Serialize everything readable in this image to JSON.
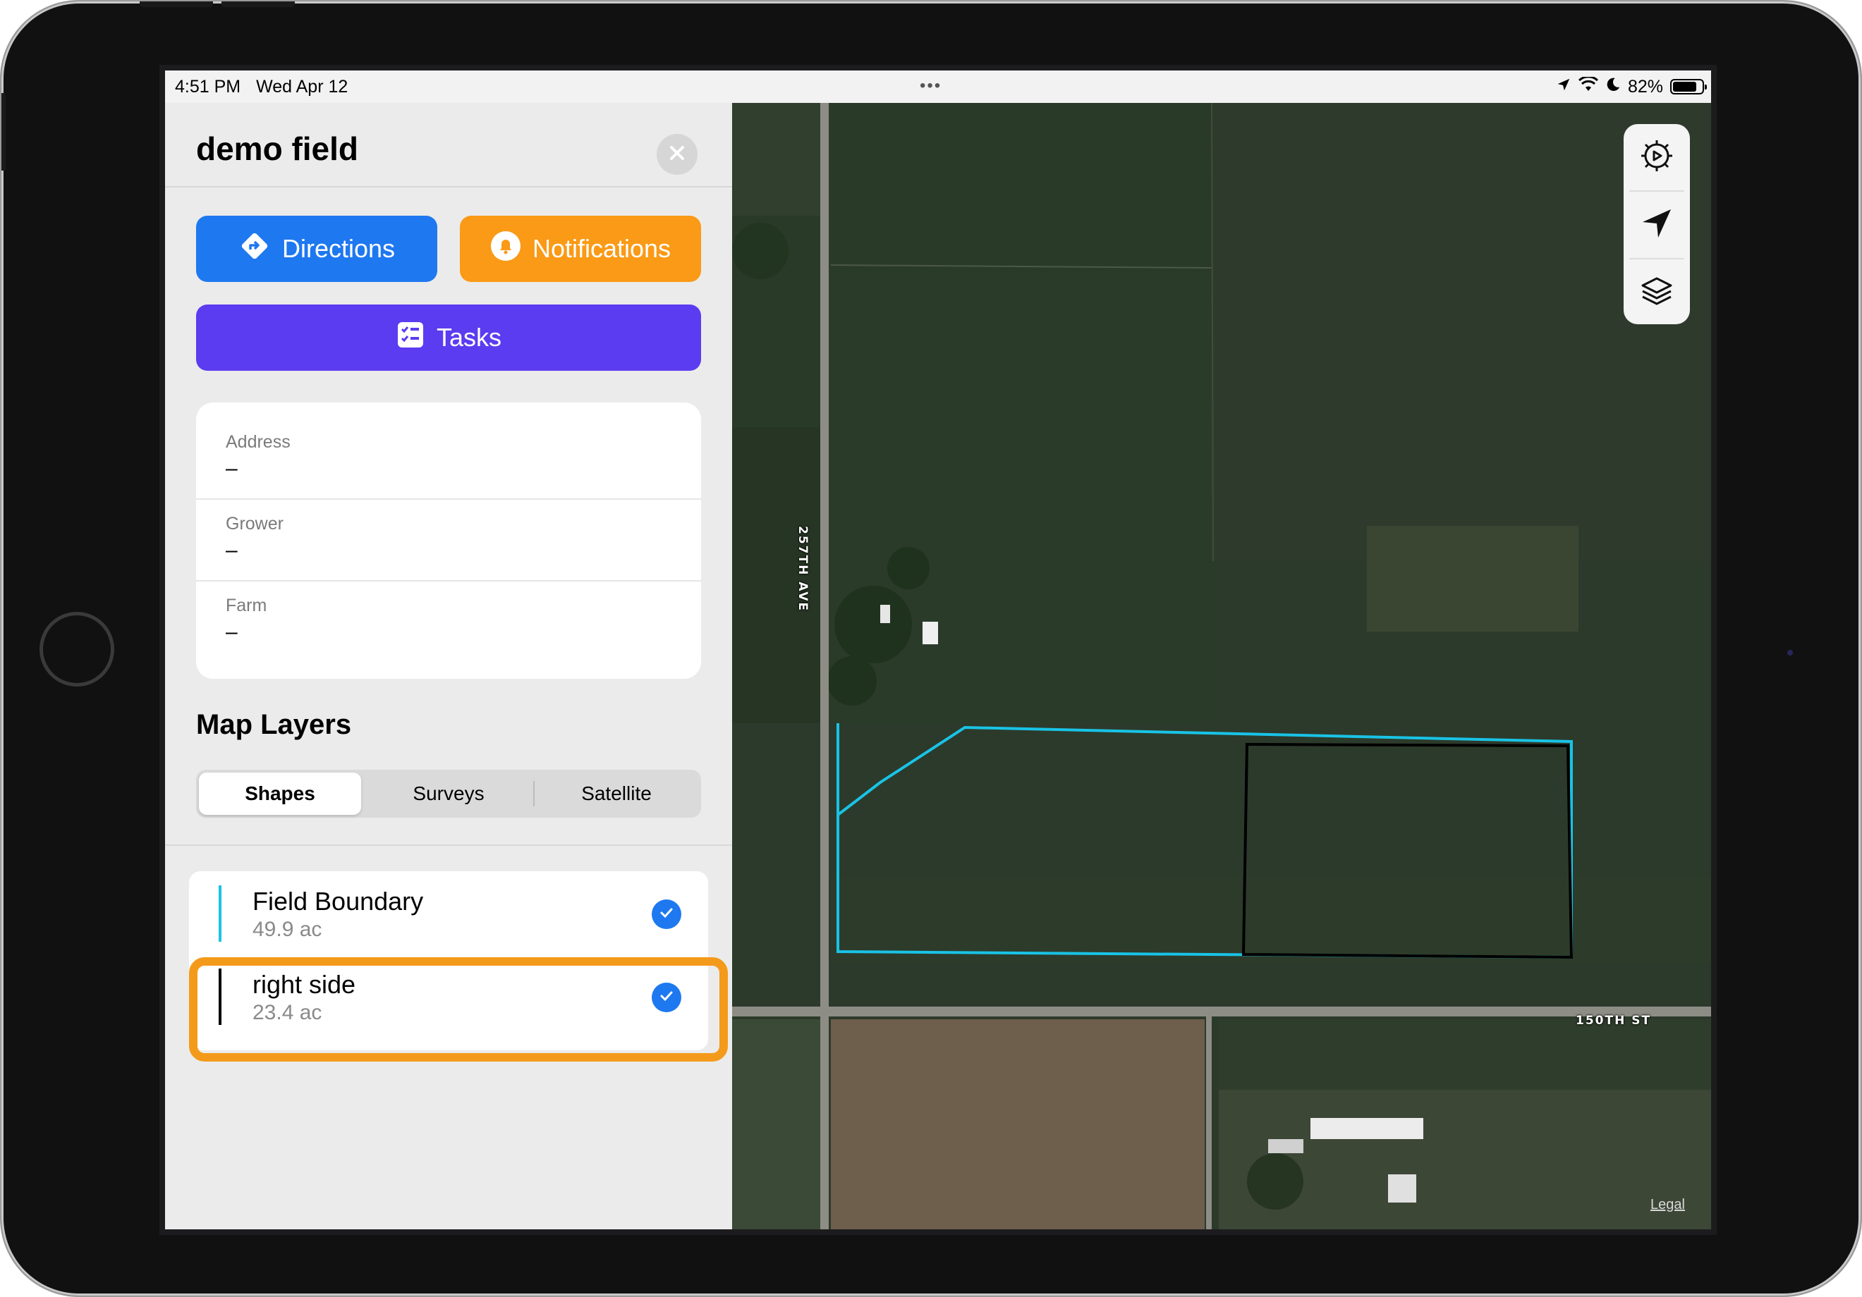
{
  "status_bar": {
    "time": "4:51 PM",
    "date": "Wed Apr 12",
    "dots": "•••",
    "battery_text": "82%",
    "battery_level": 0.82
  },
  "panel": {
    "title": "demo field",
    "buttons": {
      "directions": "Directions",
      "notifications": "Notifications",
      "tasks": "Tasks"
    },
    "info": [
      {
        "label": "Address",
        "value": "–"
      },
      {
        "label": "Grower",
        "value": "–"
      },
      {
        "label": "Farm",
        "value": "–"
      }
    ],
    "map_layers": {
      "title": "Map Layers",
      "tabs": [
        "Shapes",
        "Surveys",
        "Satellite"
      ],
      "selected_tab": "Shapes"
    },
    "layers": [
      {
        "name": "Field Boundary",
        "area": "49.9 ac",
        "color": "#19c3e6",
        "checked": true
      },
      {
        "name": "right side",
        "area": "23.4 ac",
        "color": "#000000",
        "checked": true
      }
    ]
  },
  "map": {
    "road_labels": {
      "vertical": "257TH AVE",
      "horizontal": "150TH ST"
    },
    "legal": "Legal",
    "controls": [
      "settings-icon",
      "location-arrow-icon",
      "layers-icon"
    ]
  },
  "colors": {
    "directions": "#1e78f0",
    "notifications": "#fa9a16",
    "tasks": "#5b3cf0",
    "highlight": "#f49a1a",
    "check": "#1e78f0"
  }
}
